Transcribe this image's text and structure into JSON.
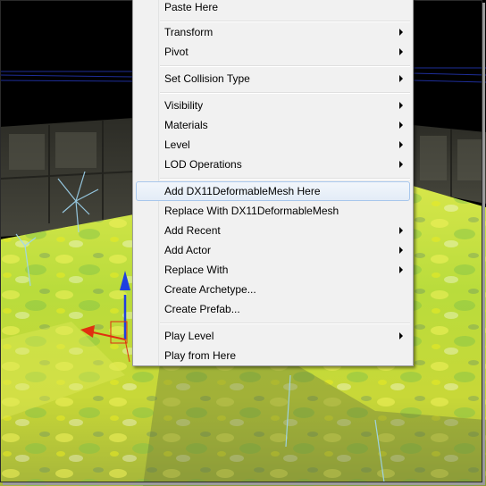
{
  "menu": {
    "items": [
      {
        "label": "Paste Here",
        "submenu": false
      },
      {
        "label": "Transform",
        "submenu": true
      },
      {
        "label": "Pivot",
        "submenu": true
      },
      {
        "label": "Set Collision Type",
        "submenu": true
      },
      {
        "label": "Visibility",
        "submenu": true
      },
      {
        "label": "Materials",
        "submenu": true
      },
      {
        "label": "Level",
        "submenu": true
      },
      {
        "label": "LOD Operations",
        "submenu": true
      },
      {
        "label": "Add DX11DeformableMesh Here",
        "submenu": false,
        "highlighted": true
      },
      {
        "label": "Replace With DX11DeformableMesh",
        "submenu": false
      },
      {
        "label": "Add Recent",
        "submenu": true
      },
      {
        "label": "Add Actor",
        "submenu": true
      },
      {
        "label": "Replace With",
        "submenu": true
      },
      {
        "label": "Create Archetype...",
        "submenu": false
      },
      {
        "label": "Create Prefab...",
        "submenu": false
      },
      {
        "label": "Play Level",
        "submenu": true
      },
      {
        "label": "Play from Here",
        "submenu": false
      }
    ]
  },
  "colors": {
    "menu_background": "#f1f1f1",
    "highlight_border": "#a8c7ec",
    "ground_green": "#b7e23a",
    "ground_yellow": "#d8e20a",
    "wall_gray": "#3b3b33",
    "gizmo_blue": "#1f3fe0",
    "gizmo_red": "#e03010"
  },
  "icons": {
    "submenu_arrow": "chevron-right-icon",
    "move_gizmo": "transform-gizmo-icon"
  }
}
